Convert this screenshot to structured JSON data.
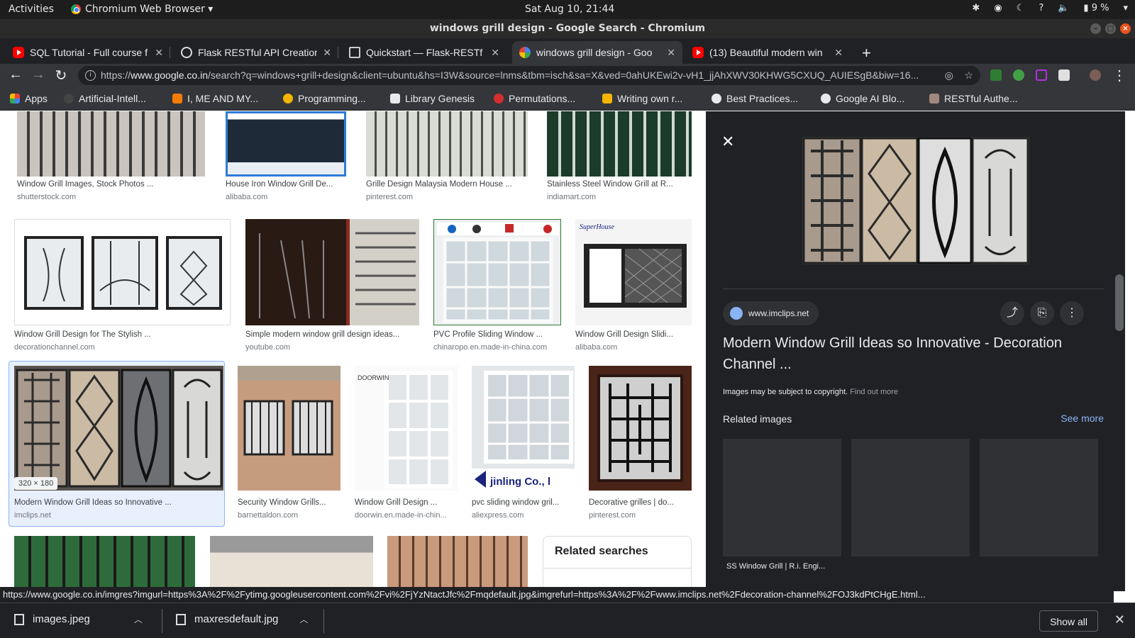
{
  "system_bar": {
    "activities": "Activities",
    "app_menu": "Chromium Web Browser ▾",
    "clock": "Sat Aug 10, 21:44",
    "battery": "9 %"
  },
  "window": {
    "title": "windows grill design - Google Search - Chromium"
  },
  "tabs": [
    {
      "title": "SQL Tutorial - Full course f",
      "icon": "youtube-icon"
    },
    {
      "title": "Flask RESTful API Creation",
      "icon": "globe-icon"
    },
    {
      "title": "Quickstart — Flask-RESTf",
      "icon": "doc-icon"
    },
    {
      "title": "windows grill design - Goo",
      "icon": "google-icon",
      "active": true
    },
    {
      "title": "(13) Beautiful modern win",
      "icon": "youtube-icon"
    }
  ],
  "toolbar": {
    "url_scheme": "https://",
    "url_host": "www.google.co.in",
    "url_rest": "/search?q=windows+grill+design&client=ubuntu&hs=I3W&source=lnms&tbm=isch&sa=X&ved=0ahUKEwi2v-vH1_jjAhXWV30KHWG5CXUQ_AUIESgB&biw=16..."
  },
  "bookmarks": [
    {
      "label": "Apps",
      "color": "#ea4335"
    },
    {
      "label": "Artificial-Intell...",
      "color": "#9aa0a6"
    },
    {
      "label": "I, ME AND MY...",
      "color": "#f57c00"
    },
    {
      "label": "Programming...",
      "color": "#f4b400"
    },
    {
      "label": "Library Genesis",
      "color": "#e8eaed"
    },
    {
      "label": "Permutations...",
      "color": "#d32f2f"
    },
    {
      "label": "Writing own r...",
      "color": "#f4b400"
    },
    {
      "label": "Best Practices...",
      "color": "#e8eaed"
    },
    {
      "label": "Google AI Blo...",
      "color": "#e8eaed"
    },
    {
      "label": "RESTful Authe...",
      "color": "#a1887f"
    }
  ],
  "results": [
    {
      "caption": "Window Grill Images, Stock Photos ...",
      "source": "shutterstock.com"
    },
    {
      "caption": "House Iron Window Grill De...",
      "source": "alibaba.com"
    },
    {
      "caption": "Grille Design Malaysia Modern House ...",
      "source": "pinterest.com"
    },
    {
      "caption": "Stainless Steel Window Grill at R...",
      "source": "indiamart.com"
    },
    {
      "caption": "Window Grill Design for The Stylish ...",
      "source": "decorationchannel.com"
    },
    {
      "caption": "Simple modern window grill design ideas...",
      "source": "youtube.com"
    },
    {
      "caption": "PVC Profile Sliding Window ...",
      "source": "chinaropo.en.made-in-china.com"
    },
    {
      "caption": "Window Grill Design Slidi...",
      "source": "alibaba.com"
    },
    {
      "caption": "Modern Window Grill Ideas so Innovative ...",
      "source": "imclips.net",
      "dims": "320 × 180"
    },
    {
      "caption": "Security Window Grills...",
      "source": "barnettaldon.com"
    },
    {
      "caption": "Window Grill Design ...",
      "source": "doorwin.en.made-in-chin..."
    },
    {
      "caption": "pvc sliding window gril...",
      "source": "aliexpress.com"
    },
    {
      "caption": "Decorative grilles | do...",
      "source": "pinterest.com"
    }
  ],
  "related_searches": {
    "title": "Related searches"
  },
  "panel": {
    "site": "www.imclips.net",
    "title": "Modern Window Grill Ideas so Innovative - Decoration Channel ...",
    "copyright": "Images may be subject to copyright.",
    "find_out_more": "Find out more",
    "related_images": "Related images",
    "see_more": "See more",
    "related_caption": "SS Window Grill | R.i. Engi..."
  },
  "status_url": "https://www.google.co.in/imgres?imgurl=https%3A%2F%2Fytimg.googleusercontent.com%2Fvi%2FjYzNtactJfc%2Fmqdefault.jpg&imgrefurl=https%3A%2F%2Fwww.imclips.net%2Fdecoration-channel%2FOJ3kdPtCHgE.html...",
  "downloads": {
    "items": [
      "images.jpeg",
      "maxresdefault.jpg"
    ],
    "show_all": "Show all"
  }
}
